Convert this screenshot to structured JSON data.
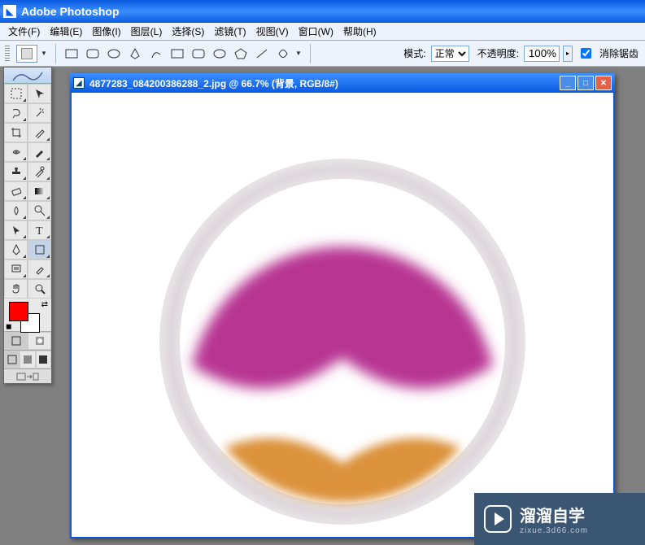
{
  "app": {
    "title": "Adobe Photoshop"
  },
  "menu": {
    "file": "文件(F)",
    "edit": "编辑(E)",
    "image": "图像(I)",
    "layer": "图层(L)",
    "select": "选择(S)",
    "filter": "滤镜(T)",
    "view": "视图(V)",
    "window": "窗口(W)",
    "help": "帮助(H)"
  },
  "options": {
    "mode_label": "模式:",
    "mode_value": "正常",
    "opacity_label": "不透明度:",
    "opacity_value": "100%",
    "antialias_label": "消除锯齿",
    "antialias_checked": true
  },
  "toolbox": {
    "fg_color": "#ff0000",
    "bg_color": "#ffffff"
  },
  "document": {
    "title": "4877283_084200386288_2.jpg @ 66.7% (背景, RGB/8#)"
  },
  "watermark": {
    "name": "溜溜自学",
    "url": "zixue.3d66.com"
  }
}
